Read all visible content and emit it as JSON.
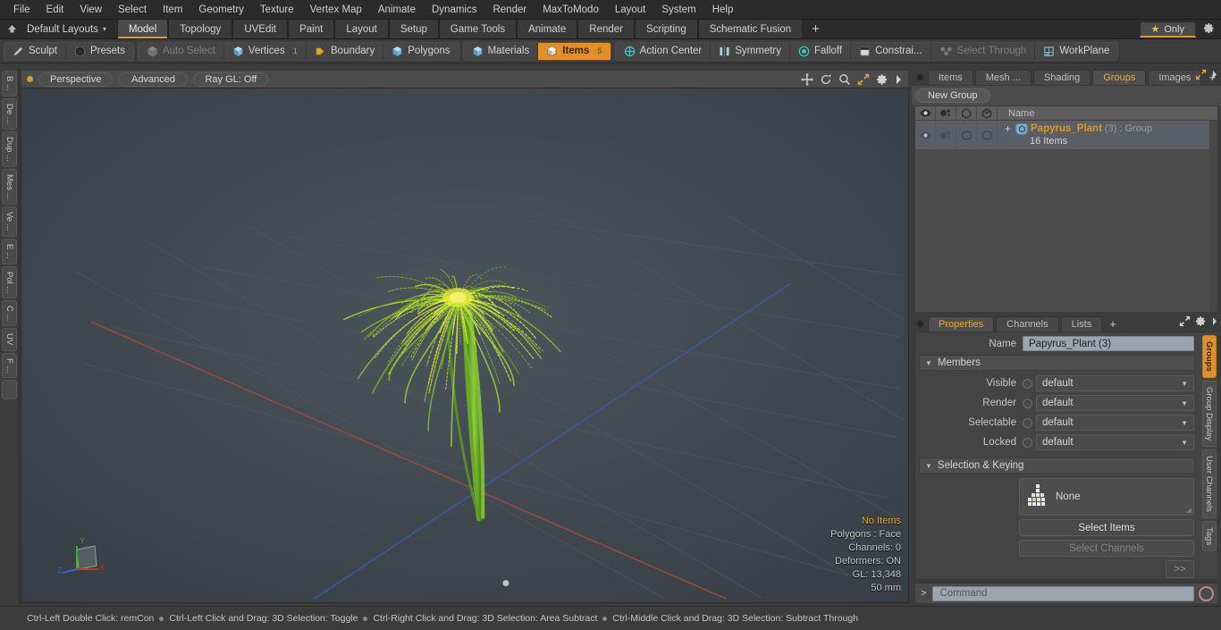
{
  "menubar": {
    "items": [
      "File",
      "Edit",
      "View",
      "Select",
      "Item",
      "Geometry",
      "Texture",
      "Vertex Map",
      "Animate",
      "Dynamics",
      "Render",
      "MaxToModo",
      "Layout",
      "System",
      "Help"
    ]
  },
  "layoutbar": {
    "home_icon": "home-icon",
    "picker_label": "Default Layouts",
    "caret": "▾",
    "tabs": [
      {
        "label": "Model",
        "active": true
      },
      {
        "label": "Topology",
        "active": false
      },
      {
        "label": "UVEdit",
        "active": false
      },
      {
        "label": "Paint",
        "active": false
      },
      {
        "label": "Layout",
        "active": false
      },
      {
        "label": "Setup",
        "active": false
      },
      {
        "label": "Game Tools",
        "active": false
      },
      {
        "label": "Animate",
        "active": false
      },
      {
        "label": "Render",
        "active": false
      },
      {
        "label": "Scripting",
        "active": false
      },
      {
        "label": "Schematic Fusion",
        "active": false
      }
    ],
    "plus": "+",
    "only_label": "Only",
    "star_glyph": "★",
    "accent": "#d79b2b"
  },
  "toolbar": {
    "group1": [
      {
        "label": "Sculpt",
        "icon": "pencil-icon",
        "state": "normal"
      },
      {
        "label": "Presets",
        "icon": "sphere-icon",
        "state": "normal"
      }
    ],
    "group2": [
      {
        "label": "Auto Select",
        "icon": "cube-grey-icon",
        "state": "dim",
        "count": ""
      },
      {
        "label": "Vertices",
        "icon": "cube-blue-icon",
        "state": "normal",
        "count": "1"
      },
      {
        "label": "Boundary",
        "icon": "boundary-icon",
        "state": "normal",
        "count": ""
      },
      {
        "label": "Polygons",
        "icon": "cube-blue-icon",
        "state": "normal",
        "count": ""
      }
    ],
    "group3": [
      {
        "label": "Materials",
        "icon": "cube-blue-icon",
        "state": "normal",
        "count": ""
      },
      {
        "label": "Items",
        "icon": "cube-orange-icon",
        "state": "active",
        "count": "5"
      }
    ],
    "group4": [
      {
        "label": "Action Center",
        "icon": "crosshair-icon",
        "state": "normal"
      },
      {
        "label": "Symmetry",
        "icon": "symmetry-icon",
        "state": "normal"
      },
      {
        "label": "Falloff",
        "icon": "falloff-icon",
        "state": "normal"
      },
      {
        "label": "Constrai...",
        "icon": "constraint-icon",
        "state": "normal"
      },
      {
        "label": "Select Through",
        "icon": "select-through-icon",
        "state": "dim"
      },
      {
        "label": "WorkPlane",
        "icon": "workplane-icon",
        "state": "normal"
      }
    ]
  },
  "left_tabs": [
    "B ...",
    "De ...",
    "Dup ...",
    "Mes ...",
    "Ve ...",
    "E ...",
    "Pol ...",
    "C ...",
    "UV",
    "F ..."
  ],
  "viewport": {
    "pills": [
      "Perspective",
      "Advanced",
      "Ray GL: Off"
    ],
    "control_icons": [
      "move-icon",
      "rotate-icon",
      "zoom-icon",
      "fit-icon",
      "gear-icon",
      "chevron-right-icon"
    ],
    "background": "#3f474b",
    "stats": {
      "selection": "No Items",
      "polygons": "Polygons : Face",
      "channels": "Channels: 0",
      "deformers": "Deformers: ON",
      "gl": "GL: 13,348",
      "grid": "50 mm"
    },
    "gizmo": {
      "x_label": "X",
      "y_label": "Y",
      "z_label": "Z",
      "x_color": "#c0392b",
      "y_color": "#3faa3f",
      "z_color": "#3a63d8"
    },
    "model_name": "papyrus-plant",
    "axis_colors": {
      "x_axis": "#b5564a",
      "z_axis": "#4a5fb5"
    }
  },
  "right_panel": {
    "tabs": [
      {
        "label": "Items",
        "active": false
      },
      {
        "label": "Mesh ...",
        "active": false
      },
      {
        "label": "Shading",
        "active": false
      },
      {
        "label": "Groups",
        "active": true
      },
      {
        "label": "Images",
        "active": false
      }
    ],
    "tab_plus": "+",
    "new_group_button": "New Group",
    "list": {
      "columns": [
        "eye-icon",
        "render-icon",
        "select-icon",
        "lock-icon"
      ],
      "name_header": "Name",
      "rows": [
        {
          "expand": "+",
          "name": "Papyrus_Plant",
          "index": "(3)",
          "type": ": Group",
          "sub": "16 Items",
          "selected": true
        }
      ]
    }
  },
  "properties": {
    "tabs": [
      {
        "label": "Properties",
        "active": true
      },
      {
        "label": "Channels",
        "active": false
      },
      {
        "label": "Lists",
        "active": false
      }
    ],
    "tab_plus": "+",
    "name_label": "Name",
    "name_value": "Papyrus_Plant (3)",
    "members_section": "Members",
    "member_rows": [
      {
        "label": "Visible",
        "value": "default"
      },
      {
        "label": "Render",
        "value": "default"
      },
      {
        "label": "Selectable",
        "value": "default"
      },
      {
        "label": "Locked",
        "value": "default"
      }
    ],
    "selection_section": "Selection & Keying",
    "none_value": "None",
    "select_items_button": "Select Items",
    "select_channels_button": "Select Channels",
    "expand_button": ">>"
  },
  "right_tabs": [
    {
      "label": "Groups",
      "active": true
    },
    {
      "label": "Group Display",
      "active": false
    },
    {
      "label": "User Channels",
      "active": false
    },
    {
      "label": "Tags",
      "active": false
    }
  ],
  "command_bar": {
    "prompt": ">",
    "placeholder": "Command",
    "record_icon": "record-circle-icon"
  },
  "statusbar": {
    "hints": [
      "Ctrl-Left Double Click: remCon",
      "Ctrl-Left Click and Drag: 3D Selection: Toggle",
      "Ctrl-Right Click and Drag: 3D Selection: Area Subtract",
      "Ctrl-Middle Click and Drag: 3D Selection: Subtract Through"
    ]
  }
}
